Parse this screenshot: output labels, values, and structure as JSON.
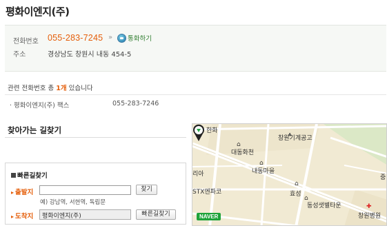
{
  "business": {
    "name": "평화이엔지(주)",
    "phone_label": "전화번호",
    "phone": "055-283-7245",
    "raquo": "»",
    "call_button": "통화하기",
    "address_label": "주소",
    "address": "경상남도 창원시 내동 454-5"
  },
  "related": {
    "prefix": "관련 전화번호 총",
    "count": "1개",
    "suffix": "있습니다",
    "items": [
      {
        "name": "· 평화이엔지(주) 팩스",
        "phone": "055-283-7246"
      }
    ]
  },
  "directions": {
    "title": "찾아가는 길찾기",
    "box_title": "빠른길찾기",
    "start_label": "출발지",
    "start_value": "",
    "find_button": "찾기",
    "example": "예) 강남역, 서현역, 독립문",
    "end_label": "도착지",
    "end_value": "평화이엔지(주)",
    "quick_button": "빠른길찾기"
  },
  "map": {
    "labels": {
      "p1": "한화",
      "p2": "창원기계공고",
      "p3": "대동화천",
      "p4": "내동마을",
      "p5": "효성",
      "p6": "동성샛별타운",
      "p7": "창원병원",
      "p8": "STX엔파코",
      "p9": "리아",
      "p10": "중"
    },
    "brand": "NAVER"
  }
}
